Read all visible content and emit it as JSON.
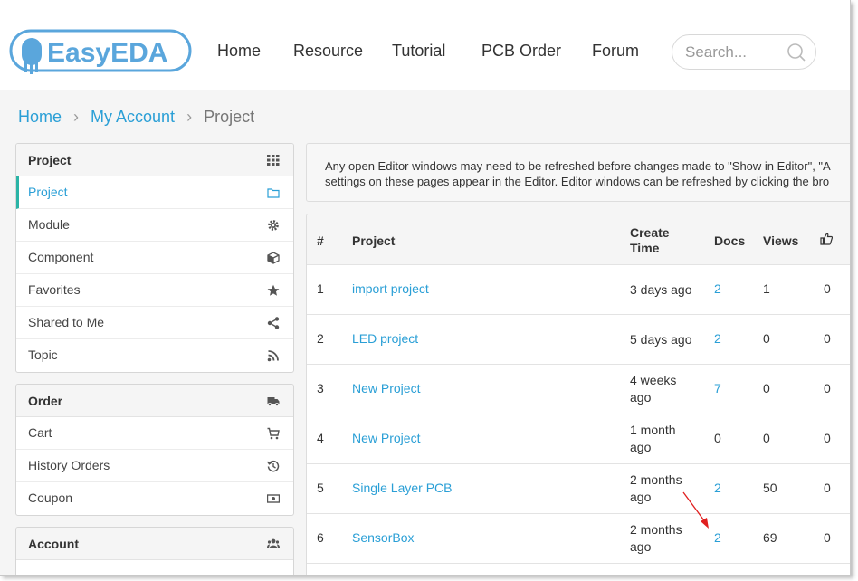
{
  "header": {
    "logo_text": "EasyEDA",
    "nav": [
      "Home",
      "Resource",
      "Tutorial",
      "PCB Order",
      "Forum"
    ],
    "search_placeholder": "Search..."
  },
  "breadcrumb": {
    "home": "Home",
    "account": "My Account",
    "current": "Project"
  },
  "sidebar": {
    "project": {
      "title": "Project",
      "items": [
        {
          "label": "Project",
          "icon": "folder-icon"
        },
        {
          "label": "Module",
          "icon": "gear-icon"
        },
        {
          "label": "Component",
          "icon": "cube-icon"
        },
        {
          "label": "Favorites",
          "icon": "star-icon"
        },
        {
          "label": "Shared to Me",
          "icon": "share-icon"
        },
        {
          "label": "Topic",
          "icon": "rss-icon"
        }
      ]
    },
    "order": {
      "title": "Order",
      "items": [
        {
          "label": "Cart",
          "icon": "cart-icon"
        },
        {
          "label": "History Orders",
          "icon": "history-icon"
        },
        {
          "label": "Coupon",
          "icon": "money-icon"
        }
      ]
    },
    "account": {
      "title": "Account"
    }
  },
  "notice": {
    "line1": "Any open Editor windows may need to be refreshed before changes made to \"Show in Editor\", \"A",
    "line2": "settings on these pages appear in the Editor. Editor windows can be refreshed by clicking the bro"
  },
  "table": {
    "headers": {
      "num": "#",
      "project": "Project",
      "create_time": "Create Time",
      "docs": "Docs",
      "views": "Views",
      "likes_icon": "thumbs-up-icon"
    },
    "rows": [
      {
        "num": "1",
        "project": "import project",
        "time": "3 days ago",
        "docs": "2",
        "views": "1",
        "likes": "0"
      },
      {
        "num": "2",
        "project": "LED project",
        "time": "5 days ago",
        "docs": "2",
        "views": "0",
        "likes": "0"
      },
      {
        "num": "3",
        "project": "New Project",
        "time": "4 weeks ago",
        "docs": "7",
        "views": "0",
        "likes": "0"
      },
      {
        "num": "4",
        "project": "New Project",
        "time": "1 month ago",
        "docs": "0",
        "views": "0",
        "likes": "0"
      },
      {
        "num": "5",
        "project": "Single Layer PCB",
        "time": "2 months ago",
        "docs": "2",
        "views": "50",
        "likes": "0"
      },
      {
        "num": "6",
        "project": "SensorBox",
        "time": "2 months ago",
        "docs": "2",
        "views": "69",
        "likes": "0"
      }
    ]
  },
  "colors": {
    "link": "#2a9fd6",
    "active_border": "#2ab4a6",
    "logo": "#5aa6dc",
    "annotation_arrow": "#e02020"
  }
}
